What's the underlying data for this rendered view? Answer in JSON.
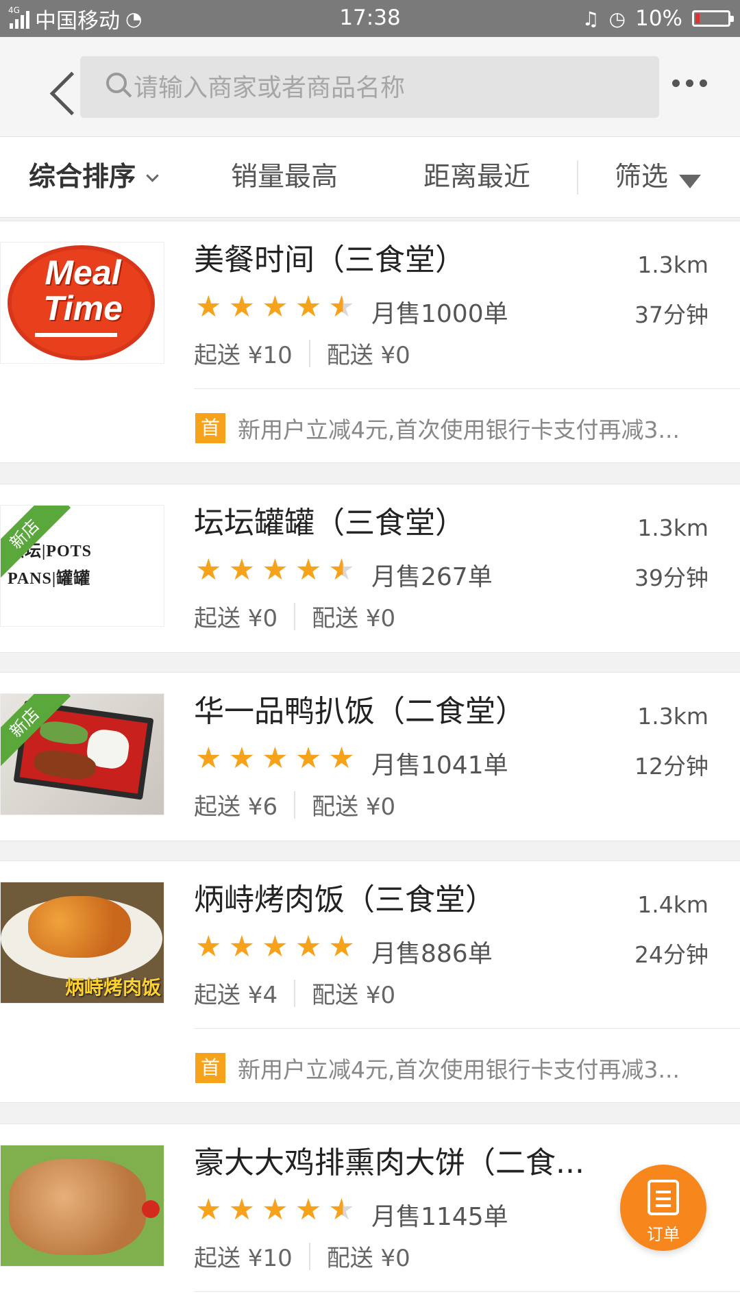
{
  "status_bar": {
    "network": "4G",
    "carrier": "中国移动",
    "time": "17:38",
    "battery": "10%"
  },
  "header": {
    "search_placeholder": "请输入商家或者商品名称"
  },
  "sort_bar": {
    "items": [
      "综合排序",
      "销量最高",
      "距离最近",
      "筛选"
    ]
  },
  "stores": [
    {
      "name": "美餐时间（三食堂）",
      "distance": "1.3km",
      "rating": 4.5,
      "sales": "月售1000单",
      "delivery_time": "37分钟",
      "min_order": "起送 ¥10",
      "delivery_fee": "配送 ¥0",
      "promo_badge": "首",
      "promo": "新用户立减4元,首次使用银行卡支付再减3..."
    },
    {
      "name": "坛坛罐罐（三食堂）",
      "distance": "1.3km",
      "rating": 4.5,
      "sales": "月售267单",
      "delivery_time": "39分钟",
      "min_order": "起送 ¥0",
      "delivery_fee": "配送 ¥0",
      "new_tag": "新店",
      "logo_text": [
        "坛坛|POTS",
        "PANS|罐罐"
      ]
    },
    {
      "name": "华一品鸭扒饭（二食堂）",
      "distance": "1.3km",
      "rating": 5,
      "sales": "月售1041单",
      "delivery_time": "12分钟",
      "min_order": "起送 ¥6",
      "delivery_fee": "配送 ¥0",
      "new_tag": "新店"
    },
    {
      "name": "炳峙烤肉饭（三食堂）",
      "distance": "1.4km",
      "rating": 5,
      "sales": "月售886单",
      "delivery_time": "24分钟",
      "min_order": "起送 ¥4",
      "delivery_fee": "配送 ¥0",
      "promo_badge": "首",
      "promo": "新用户立减4元,首次使用银行卡支付再减3...",
      "image_caption": "炳峙烤肉饭"
    },
    {
      "name": "豪大大鸡排熏肉大饼（二食...",
      "rating": 4.5,
      "sales": "月售1145单",
      "min_order": "起送 ¥10",
      "delivery_fee": "配送 ¥0"
    }
  ],
  "logo_mealtime": [
    "Meal",
    "Time"
  ],
  "order_button": {
    "label": "订单"
  },
  "colors": {
    "accent": "#f7a21b",
    "order_button": "#f7861c",
    "new_tag": "#5aa83c"
  }
}
